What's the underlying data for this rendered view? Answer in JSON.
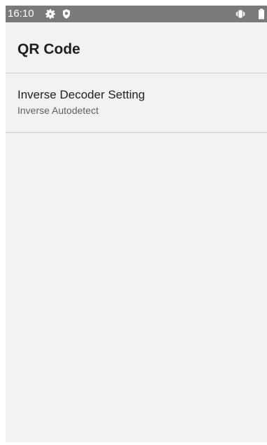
{
  "status_bar": {
    "time": "16:10",
    "icons": [
      "gear-icon",
      "shield-icon",
      "vibrate-icon",
      "battery-icon"
    ],
    "background": "#7a7a7a"
  },
  "app_bar": {
    "title": "QR Code",
    "background": "#f2f2f2"
  },
  "settings": {
    "items": [
      {
        "title": "Inverse Decoder Setting",
        "summary": "Inverse Autodetect"
      }
    ]
  },
  "colors": {
    "screen_background": "#f2f2f2",
    "divider": "#cfcfcf",
    "primary_text": "#1f1f1f",
    "secondary_text": "#5f5f5f"
  }
}
